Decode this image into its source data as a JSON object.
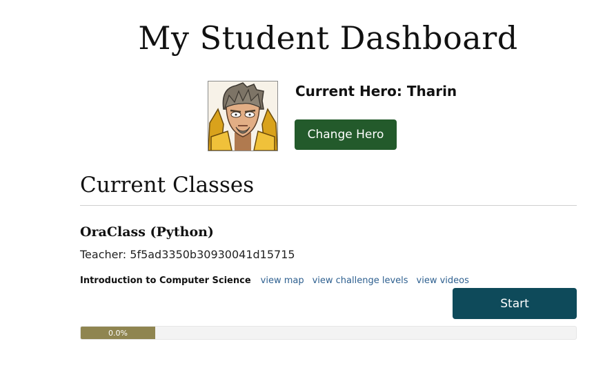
{
  "page": {
    "title": "My Student Dashboard"
  },
  "hero": {
    "name_label": "Current Hero: Tharin",
    "portrait_icon": "hero-tharin-portrait",
    "change_button_label": "Change Hero"
  },
  "classes_section": {
    "title": "Current Classes",
    "classes": [
      {
        "name": "OraClass (Python)",
        "teacher": "Teacher: 5f5ad3350b30930041d15715",
        "course": {
          "name": "Introduction to Computer Science",
          "links": [
            "view map",
            "view challenge levels",
            "view videos"
          ],
          "start_label": "Start",
          "progress_label": "0.0%",
          "progress_value": 0.0
        }
      }
    ]
  },
  "colors": {
    "change_hero_button": "#235a2b",
    "start_button": "#0e4a5a",
    "progress_fill": "#8f8550",
    "link": "#2d5f8f"
  }
}
